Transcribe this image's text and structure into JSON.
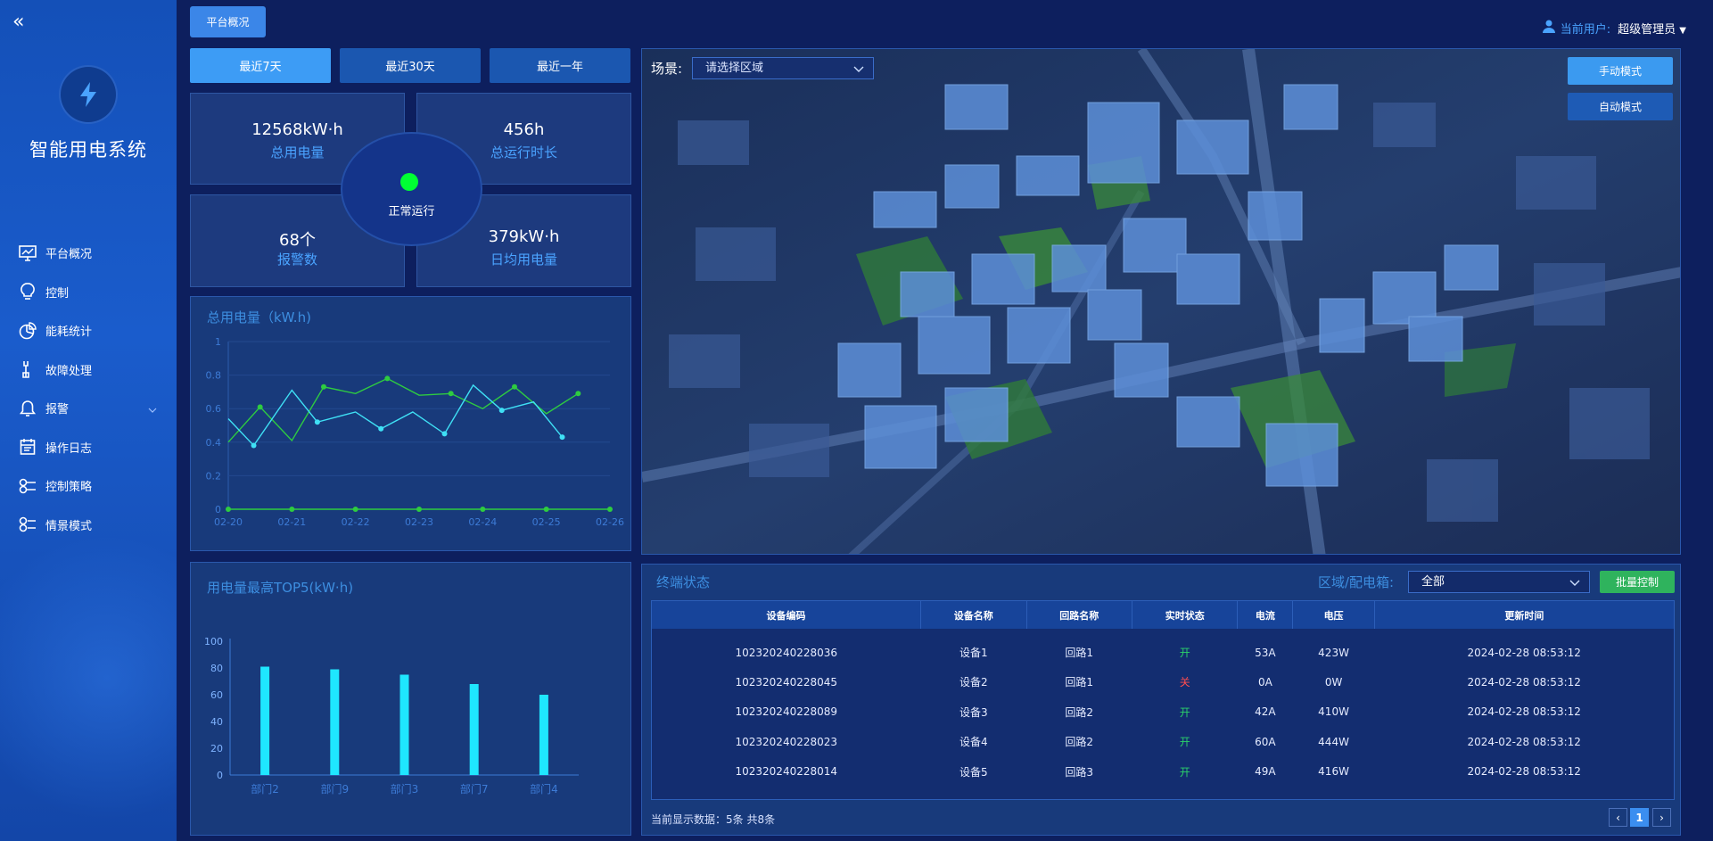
{
  "sidebar": {
    "app_title": "智能用电系统",
    "items": [
      {
        "label": "平台概况",
        "icon": "monitor-chart-icon"
      },
      {
        "label": "控制",
        "icon": "bulb-icon"
      },
      {
        "label": "能耗统计",
        "icon": "pie-icon"
      },
      {
        "label": "故障处理",
        "icon": "wrench-icon"
      },
      {
        "label": "报警",
        "icon": "bell-icon"
      },
      {
        "label": "操作日志",
        "icon": "calendar-icon"
      },
      {
        "label": "控制策略",
        "icon": "strategy-icon"
      },
      {
        "label": "情景模式",
        "icon": "scene-icon"
      }
    ]
  },
  "header": {
    "tab_label": "平台概况",
    "user_label": "当前用户:",
    "user_name": "超级管理员"
  },
  "periods": [
    "最近7天",
    "最近30天",
    "最近一年"
  ],
  "stats": {
    "total_power": {
      "value": "12568kW·h",
      "label": "总用电量"
    },
    "total_runtime": {
      "value": "456h",
      "label": "总运行时长"
    },
    "alarms": {
      "value": "68个",
      "label": "报警数"
    },
    "daily_avg": {
      "value": "379kW·h",
      "label": "日均用电量"
    },
    "status": "正常运行"
  },
  "line_panel_title": "总用电量（kW.h)",
  "bar_panel_title": "用电量最高TOP5(kW·h)",
  "map": {
    "scene_label": "场景:",
    "scene_placeholder": "请选择区域",
    "manual_btn": "手动模式",
    "auto_btn": "自动模式"
  },
  "terminal": {
    "title": "终端状态",
    "area_label": "区域/配电箱:",
    "area_value": "全部",
    "batch_btn": "批量控制",
    "columns": [
      "设备编码",
      "设备名称",
      "回路名称",
      "实时状态",
      "电流",
      "电压",
      "更新时间"
    ],
    "rows": [
      [
        "102320240228036",
        "设备1",
        "回路1",
        "开",
        "53A",
        "423W",
        "2024-02-28 08:53:12"
      ],
      [
        "102320240228045",
        "设备2",
        "回路1",
        "关",
        "0A",
        "0W",
        "2024-02-28 08:53:12"
      ],
      [
        "102320240228089",
        "设备3",
        "回路2",
        "开",
        "42A",
        "410W",
        "2024-02-28 08:53:12"
      ],
      [
        "102320240228023",
        "设备4",
        "回路2",
        "开",
        "60A",
        "444W",
        "2024-02-28 08:53:12"
      ],
      [
        "102320240228014",
        "设备5",
        "回路3",
        "开",
        "49A",
        "416W",
        "2024-02-28 08:53:12"
      ]
    ],
    "footer": "当前显示数据：5条 共8条",
    "page": "1",
    "status_colors": {
      "开": "#2bd06a",
      "关": "#ff4d4f"
    }
  },
  "chart_data": [
    {
      "type": "line",
      "x": [
        "02-20",
        "02-21",
        "02-22",
        "02-23",
        "02-24",
        "02-25",
        "02-26"
      ],
      "ylim": [
        0,
        1
      ],
      "yticks": [
        "0",
        "0.2",
        "0.4",
        "0.6",
        "0.8",
        "1"
      ],
      "series": [
        {
          "color": "#2ecc40",
          "points": [
            [
              0,
              0.4
            ],
            [
              0.5,
              0.61
            ],
            [
              1,
              0.41
            ],
            [
              1.5,
              0.73
            ],
            [
              2,
              0.69
            ],
            [
              2.5,
              0.78
            ],
            [
              3,
              0.68
            ],
            [
              3.5,
              0.69
            ],
            [
              4,
              0.6
            ],
            [
              4.5,
              0.73
            ],
            [
              5,
              0.57
            ],
            [
              5.5,
              0.69
            ]
          ]
        },
        {
          "color": "#3fe0f5",
          "points": [
            [
              0,
              0.54
            ],
            [
              0.4,
              0.38
            ],
            [
              1,
              0.71
            ],
            [
              1.4,
              0.52
            ],
            [
              2,
              0.58
            ],
            [
              2.4,
              0.48
            ],
            [
              2.9,
              0.58
            ],
            [
              3.4,
              0.45
            ],
            [
              3.85,
              0.74
            ],
            [
              4.3,
              0.59
            ],
            [
              4.8,
              0.64
            ],
            [
              5.25,
              0.43
            ]
          ]
        },
        {
          "color": "#2ecc40",
          "points": [
            [
              0,
              0
            ],
            [
              1,
              0
            ],
            [
              2,
              0
            ],
            [
              3,
              0
            ],
            [
              4,
              0
            ],
            [
              5,
              0
            ],
            [
              6,
              0
            ]
          ]
        }
      ]
    },
    {
      "type": "bar",
      "categories": [
        "部门2",
        "部门9",
        "部门3",
        "部门7",
        "部门4"
      ],
      "values": [
        81,
        79,
        75,
        68,
        60
      ],
      "ylim": [
        0,
        100
      ],
      "yticks": [
        "0",
        "20",
        "40",
        "60",
        "80",
        "100"
      ],
      "color": "#1fe6ff"
    }
  ]
}
